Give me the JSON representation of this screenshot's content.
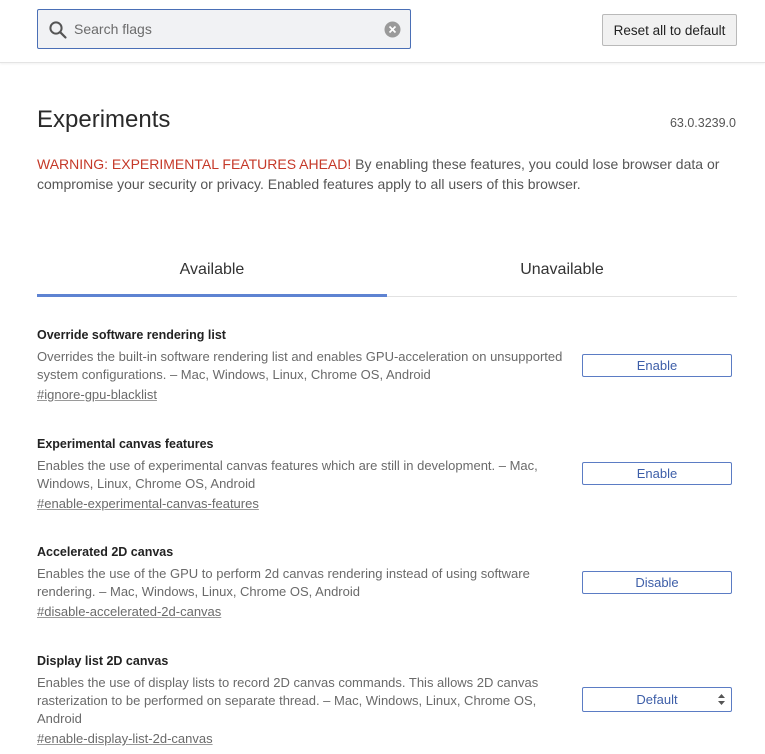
{
  "search": {
    "placeholder": "Search flags",
    "value": ""
  },
  "header": {
    "reset_label": "Reset all to default"
  },
  "page": {
    "title": "Experiments",
    "version": "63.0.3239.0",
    "warning_strong": "WARNING: EXPERIMENTAL FEATURES AHEAD!",
    "warning_text": " By enabling these features, you could lose browser data or compromise your security or privacy. Enabled features apply to all users of this browser."
  },
  "tabs": [
    {
      "label": "Available",
      "active": true
    },
    {
      "label": "Unavailable",
      "active": false
    }
  ],
  "flags": [
    {
      "title": "Override software rendering list",
      "description": "Overrides the built-in software rendering list and enables GPU-acceleration on unsupported system configurations.  – Mac, Windows, Linux, Chrome OS, Android",
      "link": "#ignore-gpu-blacklist",
      "control_type": "button",
      "control_label": "Enable"
    },
    {
      "title": "Experimental canvas features",
      "description": "Enables the use of experimental canvas features which are still in development.  – Mac, Windows, Linux, Chrome OS, Android",
      "link": "#enable-experimental-canvas-features",
      "control_type": "button",
      "control_label": "Enable"
    },
    {
      "title": "Accelerated 2D canvas",
      "description": "Enables the use of the GPU to perform 2d canvas rendering instead of using software rendering.  – Mac, Windows, Linux, Chrome OS, Android",
      "link": "#disable-accelerated-2d-canvas",
      "control_type": "button",
      "control_label": "Disable"
    },
    {
      "title": "Display list 2D canvas",
      "description": "Enables the use of display lists to record 2D canvas commands. This allows 2D canvas rasterization to be performed on separate thread.  – Mac, Windows, Linux, Chrome OS, Android",
      "link": "#enable-display-list-2d-canvas",
      "control_type": "select",
      "control_label": "Default"
    }
  ],
  "icons": {
    "search": "search-icon",
    "clear": "clear-icon",
    "select_arrows": "up-down-arrows-icon"
  },
  "colors": {
    "accent": "#5e83d2",
    "warning": "#c53929",
    "control_text": "#3d5ea8"
  }
}
